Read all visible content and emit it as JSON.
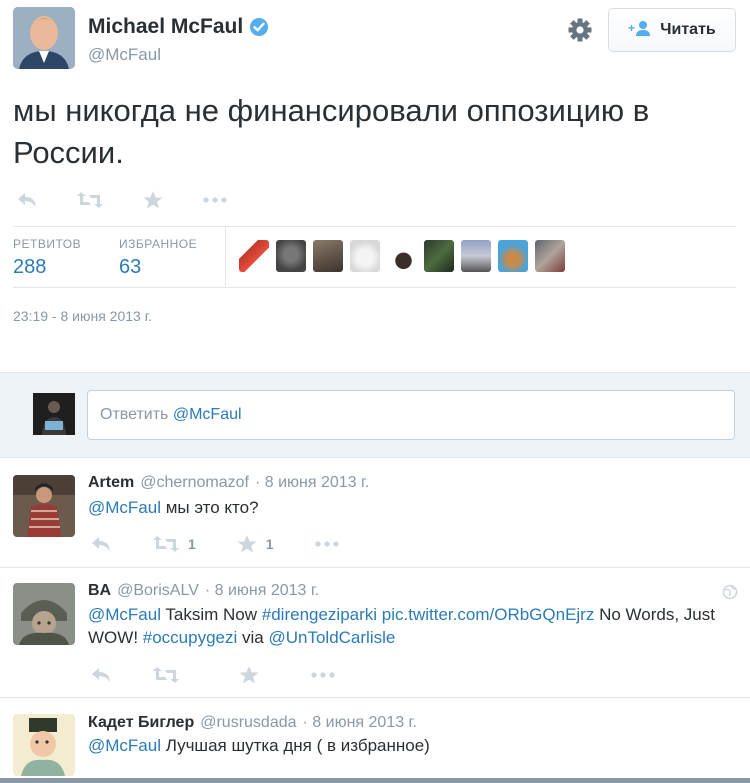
{
  "author": {
    "name": "Michael McFaul",
    "handle": "@McFaul"
  },
  "follow_button_label": "Читать",
  "tweet_text": "мы никогда не финансировали оппозицию в России.",
  "stats": {
    "retweets_label": "РЕТВИТОВ",
    "retweets": "288",
    "favorites_label": "ИЗБРАННОЕ",
    "favorites": "63"
  },
  "timestamp": "23:19 - 8 июня 2013 г.",
  "reply_box": {
    "prefix": "Ответить ",
    "mention": "@McFaul"
  },
  "replies": [
    {
      "name": "Artem",
      "handle": "@chernomazof",
      "date": "· 8 июня 2013 г.",
      "mention": "@McFaul",
      "text": " мы это кто?",
      "retweets": "1",
      "favorites": "1"
    },
    {
      "name": "BA",
      "handle": "@BorisALV",
      "date": "· 8 июня 2013 г.",
      "mention": "@McFaul",
      "text1": " Taksim Now ",
      "hashtag1": "#direngeziparki",
      "space1": " ",
      "link": "pic.twitter.com/ORbGQnEjrz",
      "text2": " No Words, Just WOW! ",
      "hashtag2": "#occupygezi",
      "text3": " via ",
      "mention2": "@UnToldCarlisle"
    },
    {
      "name": "Кадет Биглер",
      "handle": "@rusrusdada",
      "date": "· 8 июня 2013 г.",
      "mention": "@McFaul",
      "text": " Лучшая шутка дня ( в избранное)"
    }
  ],
  "colors": {
    "accent": "#2b7bb9",
    "muted": "#8899a6",
    "verified": "#55acee"
  }
}
